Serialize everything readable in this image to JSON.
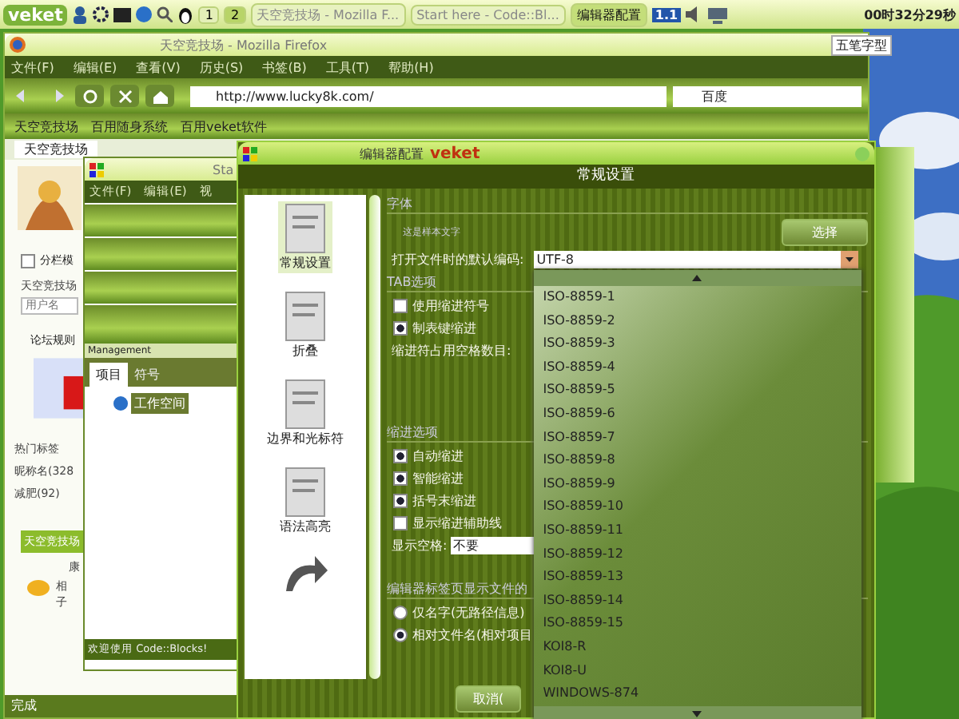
{
  "taskbar": {
    "logo": "veket",
    "workspaces": [
      {
        "label": "1",
        "selected": false
      },
      {
        "label": "2",
        "selected": true
      }
    ],
    "tasks": [
      {
        "label": "天空竞技场 - Mozilla F...",
        "selected": false
      },
      {
        "label": "Start here - Code::Bl...",
        "selected": false
      },
      {
        "label": "编辑器配置",
        "selected": true
      }
    ],
    "indicator": "1.1",
    "clock": "00时32分29秒",
    "input_method": "五笔字型"
  },
  "firefox": {
    "title": "天空竞技场 - Mozilla Firefox",
    "menu": [
      "文件(F)",
      "编辑(E)",
      "查看(V)",
      "历史(S)",
      "书签(B)",
      "工具(T)",
      "帮助(H)"
    ],
    "url": "http://www.lucky8k.com/",
    "search": "百度",
    "bookmarks": [
      "天空竞技场",
      "百用随身系统",
      "百用veket软件"
    ],
    "tab": "天空竞技场",
    "page": {
      "checkbox": {
        "label": "分栏模",
        "checked": false
      },
      "forum_label": "天空竞技场",
      "username_placeholder": "用户名",
      "rules_link": "论坛规则",
      "hot_tags_title": "热门标签",
      "tags": [
        "昵称名(328",
        "减肥(92)"
      ],
      "section_title": "天空竞技场",
      "col": "康",
      "post_lines": [
        "相",
        "子"
      ]
    },
    "status": "完成"
  },
  "codeblocks": {
    "title": "Sta",
    "menu": [
      "文件(F)",
      "编辑(E)",
      "视"
    ],
    "management": "Management",
    "tabs": [
      {
        "label": "项目",
        "selected": true
      },
      {
        "label": "符号",
        "selected": false
      }
    ],
    "tree_item": "工作空间",
    "status": "欢迎使用 Code::Blocks!"
  },
  "dialog": {
    "title": "编辑器配置",
    "brand": "veket",
    "header": "常规设置",
    "categories": [
      {
        "label": "常规设置",
        "selected": true
      },
      {
        "label": "折叠",
        "selected": false
      },
      {
        "label": "边界和光标符",
        "selected": false
      },
      {
        "label": "语法高亮",
        "selected": false
      }
    ],
    "font_group": "字体",
    "font_sample": "这是样本文字",
    "choose_button": "选择",
    "encoding_label": "打开文件时的默认编码:",
    "encoding_value": "UTF-8",
    "tab_group": "TAB选项",
    "tab_options": [
      {
        "label": "使用缩进符号",
        "checked": false
      },
      {
        "label": "制表键缩进",
        "checked": true
      }
    ],
    "indent_width_label": "缩进符占用空格数目:",
    "indent_group": "缩进选项",
    "indent_options": [
      {
        "label": "自动缩进",
        "checked": true
      },
      {
        "label": "智能缩进",
        "checked": true
      },
      {
        "label": "括号末缩进",
        "checked": true
      },
      {
        "label": "显示缩进辅助线",
        "checked": false
      }
    ],
    "spaces_label": "显示空格:",
    "spaces_value": "不要",
    "tabs_group": "编辑器标签页显示文件的",
    "tab_name_options": [
      {
        "label": "仅名字(无路径信息)",
        "selected": false
      },
      {
        "label": "相对文件名(相对项目",
        "selected": true
      }
    ],
    "cancel_button": "取消(",
    "encoding_list": [
      "ISO-8859-1",
      "ISO-8859-2",
      "ISO-8859-3",
      "ISO-8859-4",
      "ISO-8859-5",
      "ISO-8859-6",
      "ISO-8859-7",
      "ISO-8859-8",
      "ISO-8859-9",
      "ISO-8859-10",
      "ISO-8859-11",
      "ISO-8859-12",
      "ISO-8859-13",
      "ISO-8859-14",
      "ISO-8859-15",
      "KOI8-R",
      "KOI8-U",
      "WINDOWS-874"
    ]
  }
}
